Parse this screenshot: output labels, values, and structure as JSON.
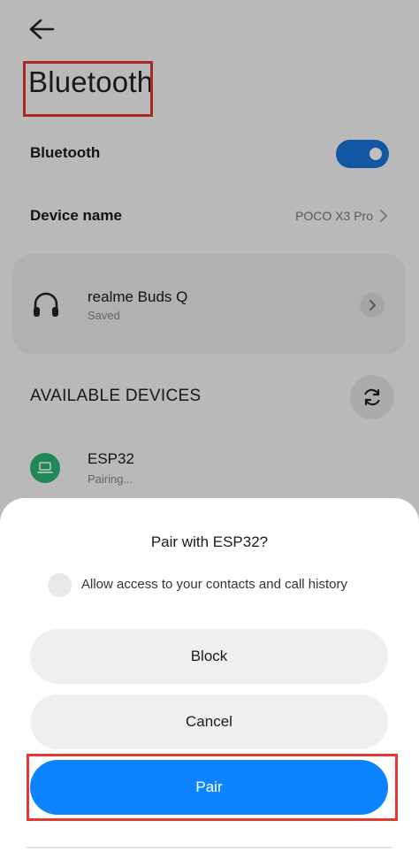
{
  "header": {
    "title": "Bluetooth"
  },
  "settings": {
    "bluetooth_label": "Bluetooth",
    "bluetooth_on": true,
    "device_name_label": "Device name",
    "device_name_value": "POCO X3 Pro"
  },
  "saved_device": {
    "name": "realme Buds Q",
    "status": "Saved",
    "icon": "headphones-icon"
  },
  "available": {
    "heading": "AVAILABLE DEVICES",
    "devices": [
      {
        "name": "ESP32",
        "status": "Pairing...",
        "icon": "laptop-icon"
      }
    ]
  },
  "dialog": {
    "title": "Pair with ESP32?",
    "checkbox_label": "Allow access to your contacts and call history",
    "block_label": "Block",
    "cancel_label": "Cancel",
    "pair_label": "Pair"
  },
  "colors": {
    "accent": "#0d84ff",
    "toggle": "#1a73d9",
    "device_icon": "#2bb673",
    "highlight": "#e53935"
  }
}
